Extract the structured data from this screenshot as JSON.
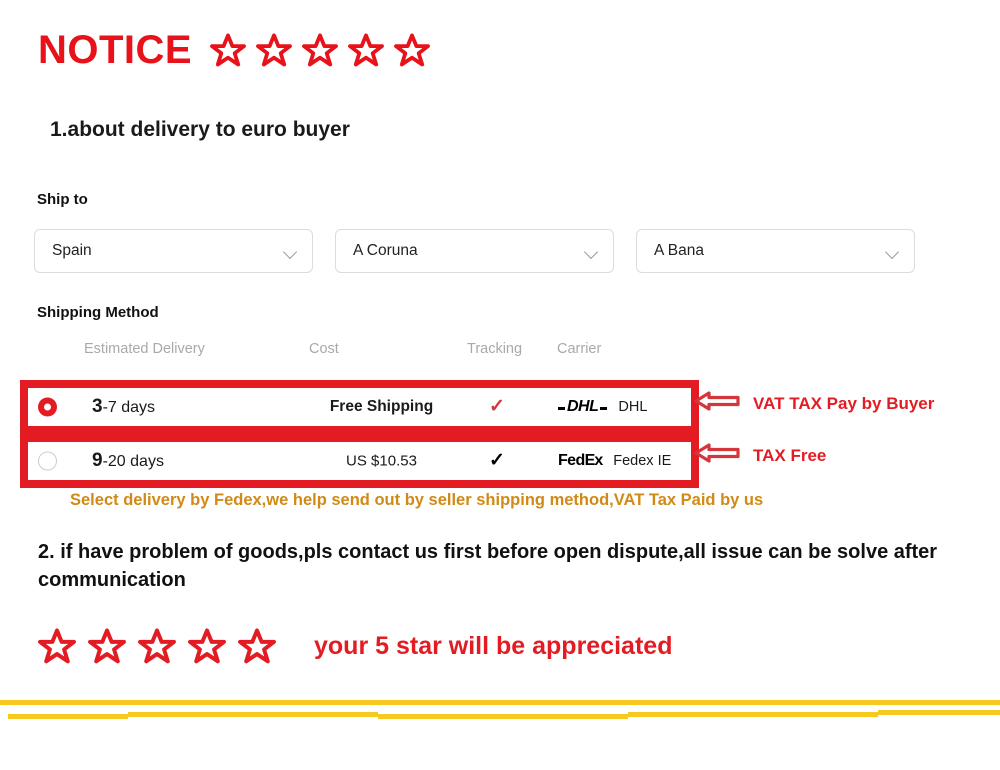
{
  "title": {
    "text": "NOTICE",
    "star_count": 5,
    "color": "#e8121a"
  },
  "section_1": {
    "heading": "1.about delivery to euro buyer"
  },
  "ship_to": {
    "label": "Ship to",
    "selects": [
      {
        "name": "country-select",
        "value": "Spain"
      },
      {
        "name": "province-select",
        "value": "A Coruna"
      },
      {
        "name": "city-select",
        "value": "A Bana"
      }
    ]
  },
  "shipping_method": {
    "label": "Shipping Method",
    "columns": {
      "delivery": "Estimated Delivery",
      "cost": "Cost",
      "tracking": "Tracking",
      "carrier": "Carrier"
    },
    "rows": [
      {
        "selected": true,
        "delivery_lead": "3",
        "delivery_rest": "-7 days",
        "cost": "Free Shipping",
        "cost_free": true,
        "tracking_check": "✓",
        "tracking_color": "#d3373c",
        "carrier_logo": "DHL",
        "carrier_name": "DHL",
        "annotation": "VAT TAX Pay by Buyer"
      },
      {
        "selected": false,
        "delivery_lead": "9",
        "delivery_rest": "-20 days",
        "cost": "US $10.53",
        "cost_free": false,
        "tracking_check": "✓",
        "tracking_color": "#000000",
        "carrier_logo": "FedEx",
        "carrier_name": "Fedex IE",
        "annotation": "TAX Free"
      }
    ]
  },
  "gold_note": "Select delivery by Fedex,we help send out by seller shipping method,VAT Tax Paid by us",
  "section_2": {
    "text": "2. if have problem of goods,pls contact us first before open dispute,all issue can be solve after communication"
  },
  "footer": {
    "star_count": 5,
    "tagline": "your 5 star will be appreciated"
  },
  "colors": {
    "red": "#e31c24",
    "gold": "#f7c81e",
    "gold_text": "#d18a16"
  }
}
